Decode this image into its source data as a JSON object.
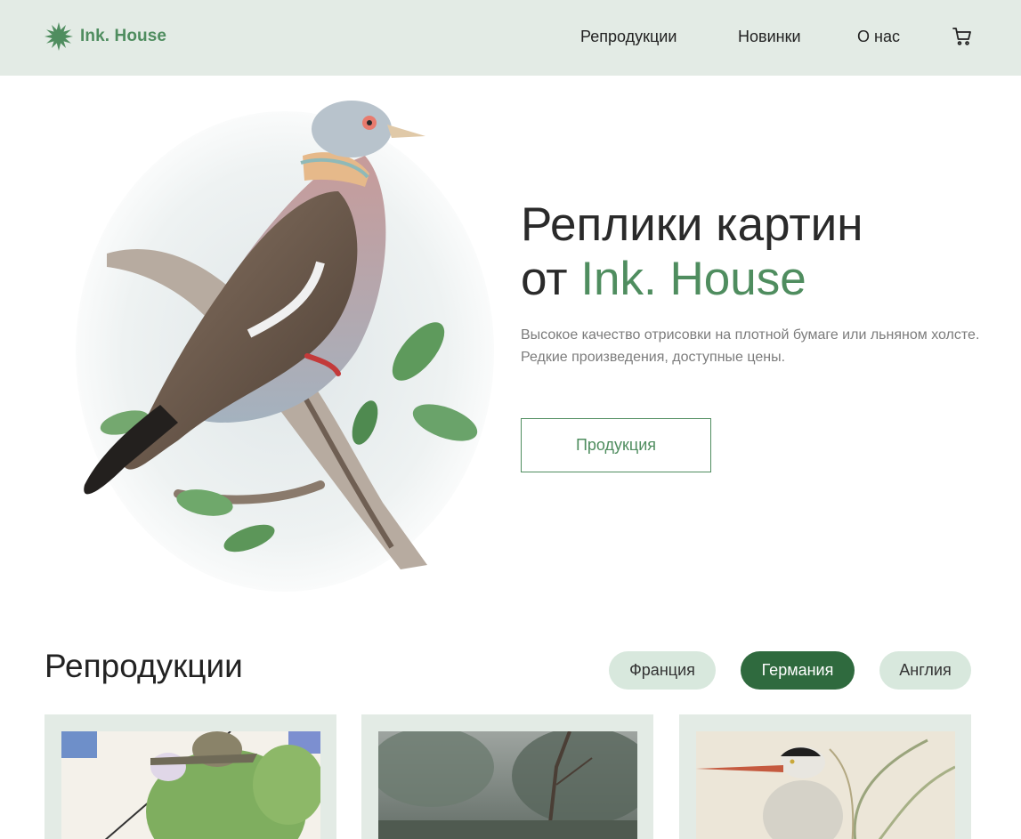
{
  "brand": {
    "name": "Ink. House",
    "logo_icon": "starburst-icon",
    "accent_color": "#4f8d5f",
    "dark_accent_color": "#2f6a3e",
    "header_bg": "#e3ebe5"
  },
  "nav": {
    "items": [
      "Репродукции",
      "Новинки",
      "О нас"
    ],
    "cart_icon": "cart-icon"
  },
  "hero": {
    "title_line1": "Реплики картин",
    "title_line2_prefix": "от ",
    "title_line2_accent": "Ink. House",
    "description": "Высокое качество отрисовки на плотной бумаге или льняном холсте. Редкие произведения, доступные цены.",
    "button_label": "Продукция",
    "image": "pigeon-illustration"
  },
  "reproductions": {
    "title": "Репродукции",
    "filters": [
      {
        "label": "Франция",
        "active": false
      },
      {
        "label": "Германия",
        "active": true
      },
      {
        "label": "Англия",
        "active": false
      }
    ],
    "cards": [
      {
        "image": "illustrated-figure-artwork"
      },
      {
        "image": "misty-forest-painting"
      },
      {
        "image": "heron-illustration"
      }
    ]
  }
}
